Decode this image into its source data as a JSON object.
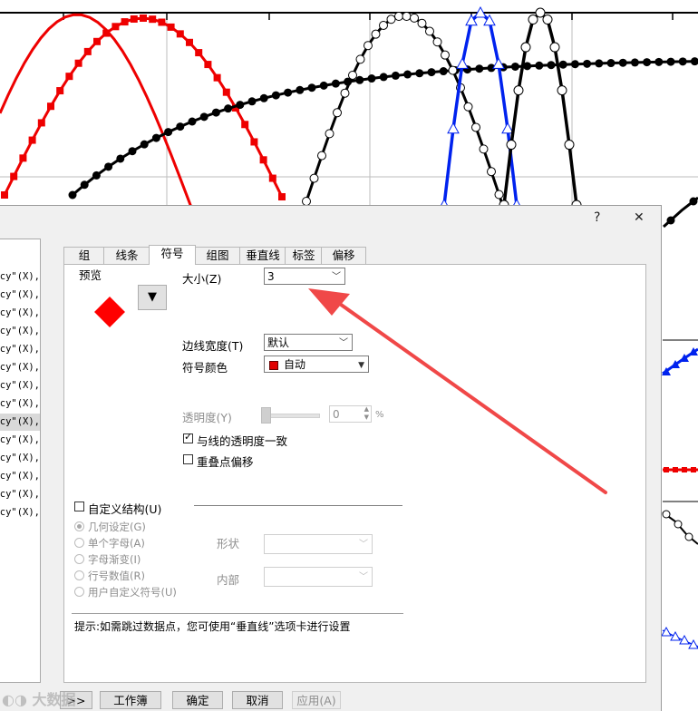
{
  "dialog": {
    "help_label": "?",
    "close_label": "✕",
    "list_rows": [
      "ncy\"(X),",
      "ncy\"(X),",
      "ncy\"(X),",
      "ncy\"(X),",
      "ncy\"(X),",
      "ncy\"(X),",
      "ncy\"(X),",
      "ncy\"(X),",
      "ncy\"(X),",
      "ncy\"(X),",
      "ncy\"(X),",
      "ncy\"(X),",
      "ncy\"(X),",
      "ncy\"(X),"
    ],
    "list_scroll_arrow": "›",
    "tabs": [
      "组",
      "线条",
      "符号",
      "组图",
      "垂直线",
      "标签",
      "偏移"
    ],
    "active_tab": "符号",
    "preview_label": "预览",
    "preview_color": "#ff0000",
    "preview_dropdown_glyph": "▼",
    "size_label": "大小(Z)",
    "size_value": "3",
    "edge_width_label": "边线宽度(T)",
    "edge_width_value": "默认",
    "symbol_color_label": "符号颜色",
    "symbol_color_value": "自动",
    "symbol_color_swatch": "#e00000",
    "transparency_label": "透明度(Y)",
    "transparency_value": "0",
    "transparency_unit": "%",
    "match_line_transparency_label": "与线的透明度一致",
    "match_line_transparency_checked": true,
    "overlap_offset_label": "重叠点偏移",
    "overlap_offset_checked": false,
    "custom_structure_label": "自定义结构(U)",
    "custom_structure_checked": false,
    "radio_options": [
      "几何设定(G)",
      "单个字母(A)",
      "字母渐变(I)",
      "行号数值(R)",
      "用户自定义符号(U)"
    ],
    "radio_selected_index": 0,
    "shape_label": "形状",
    "inner_label": "内部",
    "hint_text": "提示:如需跳过数据点，您可使用“垂直线”选项卡进行设置",
    "expand_button": ">>",
    "workbook_button": "工作簿",
    "ok_button": "确定",
    "cancel_button": "取消",
    "apply_button": "应用(A)",
    "watermark": "大数据"
  }
}
